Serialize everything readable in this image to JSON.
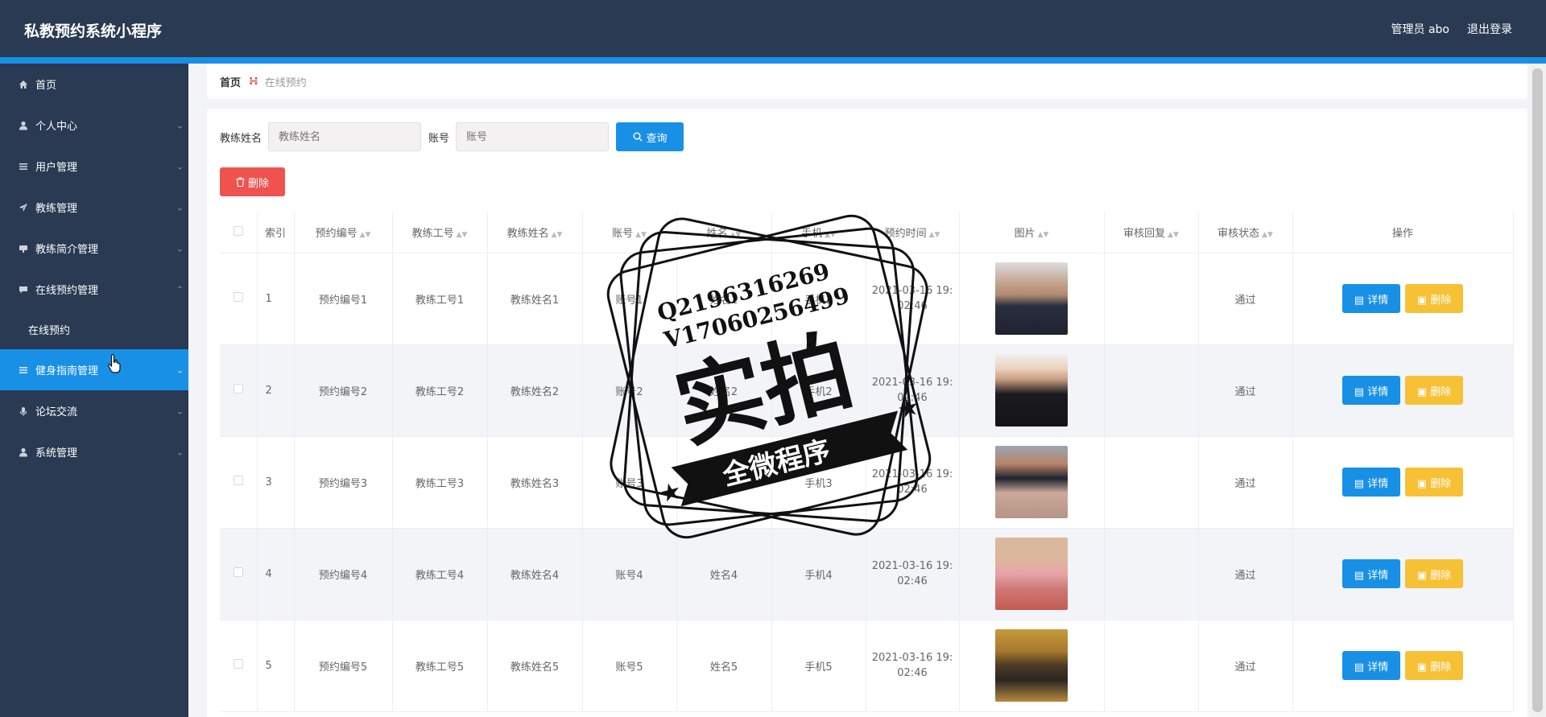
{
  "app": {
    "title": "私教预约系统小程序",
    "admin_label": "管理员 abo",
    "logout_label": "退出登录"
  },
  "sidebar": {
    "items": [
      {
        "label": "首页",
        "icon": "home-icon",
        "expandable": false
      },
      {
        "label": "个人中心",
        "icon": "user-icon",
        "expandable": true
      },
      {
        "label": "用户管理",
        "icon": "list-icon",
        "expandable": true
      },
      {
        "label": "教练管理",
        "icon": "send-icon",
        "expandable": true
      },
      {
        "label": "教练简介管理",
        "icon": "card-icon",
        "expandable": true
      },
      {
        "label": "在线预约管理",
        "icon": "chat-icon",
        "expandable": true,
        "expanded": true,
        "sub": "在线预约"
      },
      {
        "label": "健身指南管理",
        "icon": "list-icon",
        "expandable": true,
        "active": true
      },
      {
        "label": "论坛交流",
        "icon": "mic-icon",
        "expandable": true
      },
      {
        "label": "系统管理",
        "icon": "user-icon",
        "expandable": true
      }
    ]
  },
  "breadcrumb": {
    "home": "首页",
    "current": "在线预约"
  },
  "search": {
    "coach_label": "教练姓名",
    "coach_placeholder": "教练姓名",
    "account_label": "账号",
    "account_placeholder": "账号",
    "button_label": "查询"
  },
  "toolbar": {
    "delete_label": "删除"
  },
  "table": {
    "columns": [
      "索引",
      "预约编号",
      "教练工号",
      "教练姓名",
      "账号",
      "姓名",
      "手机",
      "预约时间",
      "图片",
      "审核回复",
      "审核状态",
      "操作"
    ],
    "rows": [
      {
        "idx": "1",
        "no": "预约编号1",
        "coach_id": "教练工号1",
        "coach_name": "教练姓名1",
        "account": "账号1",
        "name": "姓名1",
        "phone": "手机1",
        "time1": "2021-03-16 19:",
        "time2": "02:46",
        "reply": "",
        "status": "通过"
      },
      {
        "idx": "2",
        "no": "预约编号2",
        "coach_id": "教练工号2",
        "coach_name": "教练姓名2",
        "account": "账号2",
        "name": "姓名2",
        "phone": "手机2",
        "time1": "2021-03-16 19:",
        "time2": "02:46",
        "reply": "",
        "status": "通过"
      },
      {
        "idx": "3",
        "no": "预约编号3",
        "coach_id": "教练工号3",
        "coach_name": "教练姓名3",
        "account": "账号3",
        "name": "姓名3",
        "phone": "手机3",
        "time1": "2021-03-16 19:",
        "time2": "02:46",
        "reply": "",
        "status": "通过"
      },
      {
        "idx": "4",
        "no": "预约编号4",
        "coach_id": "教练工号4",
        "coach_name": "教练姓名4",
        "account": "账号4",
        "name": "姓名4",
        "phone": "手机4",
        "time1": "2021-03-16 19:",
        "time2": "02:46",
        "reply": "",
        "status": "通过"
      },
      {
        "idx": "5",
        "no": "预约编号5",
        "coach_id": "教练工号5",
        "coach_name": "教练姓名5",
        "account": "账号5",
        "name": "姓名5",
        "phone": "手机5",
        "time1": "2021-03-16 19:",
        "time2": "02:46",
        "reply": "",
        "status": "通过"
      }
    ],
    "detail_label": "详情",
    "delete_label": "删除"
  },
  "watermark": {
    "line1": "Q2196316269",
    "line2": "V17060256499",
    "big": "实拍",
    "banner": "全微程序"
  },
  "colors": {
    "header_bg": "#293a52",
    "accent": "#1890e6",
    "danger": "#ef5350",
    "warning": "#f7c136"
  }
}
